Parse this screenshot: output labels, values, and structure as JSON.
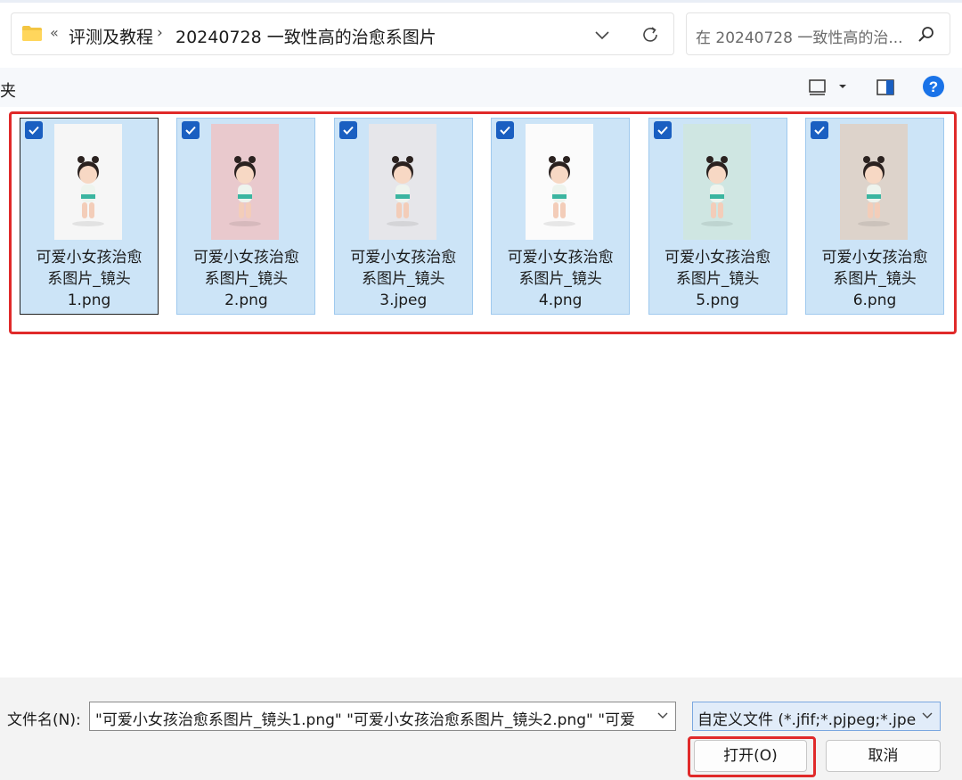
{
  "addressbar": {
    "overflow_glyph": "«",
    "crumbs": [
      "评测及教程",
      "20240728 一致性高的治愈系图片"
    ],
    "separator": "›"
  },
  "search": {
    "placeholder": "在 20240728 一致性高的治..."
  },
  "navpane": {
    "label": "夹"
  },
  "files": [
    {
      "name": "可爱小女孩治愈系图片_镜头1.png",
      "line1": "可爱小女孩治愈",
      "line2": "系图片_镜头",
      "line3": "1.png",
      "selected": true,
      "bg": "#f6f6f6"
    },
    {
      "name": "可爱小女孩治愈系图片_镜头2.png",
      "line1": "可爱小女孩治愈",
      "line2": "系图片_镜头",
      "line3": "2.png",
      "selected": true,
      "bg": "#e9c9cd"
    },
    {
      "name": "可爱小女孩治愈系图片_镜头3.jpeg",
      "line1": "可爱小女孩治愈",
      "line2": "系图片_镜头",
      "line3": "3.jpeg",
      "selected": true,
      "bg": "#e6e6ea"
    },
    {
      "name": "可爱小女孩治愈系图片_镜头4.png",
      "line1": "可爱小女孩治愈",
      "line2": "系图片_镜头",
      "line3": "4.png",
      "selected": true,
      "bg": "#fbfbfb"
    },
    {
      "name": "可爱小女孩治愈系图片_镜头5.png",
      "line1": "可爱小女孩治愈",
      "line2": "系图片_镜头",
      "line3": "5.png",
      "selected": true,
      "bg": "#cfe6e2"
    },
    {
      "name": "可爱小女孩治愈系图片_镜头6.png",
      "line1": "可爱小女孩治愈",
      "line2": "系图片_镜头",
      "line3": "6.png",
      "selected": true,
      "bg": "#ddd3cb"
    }
  ],
  "bottom": {
    "filename_label": "文件名(N):",
    "filename_value": "\"可爱小女孩治愈系图片_镜头1.png\" \"可爱小女孩治愈系图片_镜头2.png\" \"可爱",
    "filetype_value": "自定义文件 (*.jfif;*.pjpeg;*.jpeg",
    "open_label": "打开(O)",
    "cancel_label": "取消"
  },
  "colors": {
    "accent": "#1a5fc1",
    "tile_selected_bg": "#cce4f7",
    "highlight_red": "#e02a2a",
    "help_blue": "#1a73e8"
  },
  "icons": [
    "folder-icon",
    "chevron-down-icon",
    "refresh-icon",
    "search-icon",
    "view-layout-icon",
    "preview-pane-icon",
    "help-icon",
    "checkbox-checked-icon"
  ]
}
